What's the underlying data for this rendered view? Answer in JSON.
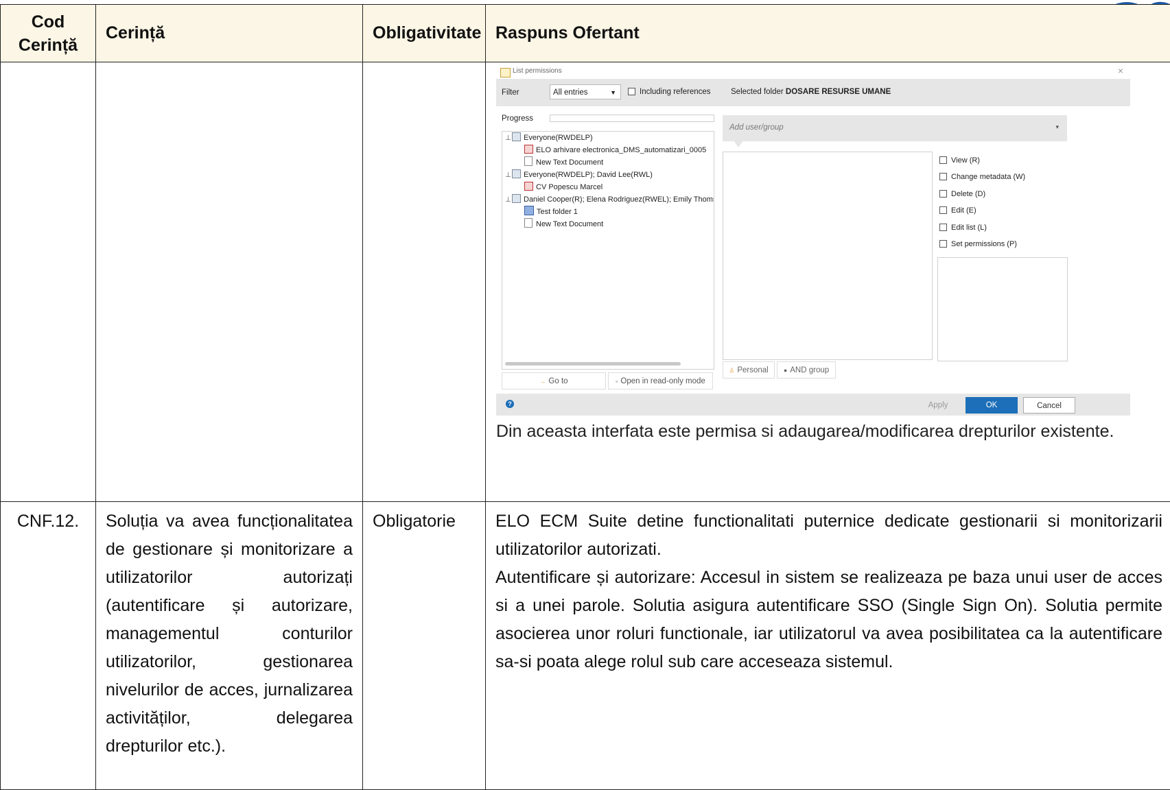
{
  "table": {
    "headers": [
      "Cod Cerință",
      "Cerință",
      "Obligativitate",
      "Raspuns Ofertant"
    ],
    "row1": {
      "code": "",
      "requirement": "",
      "mandatory": "",
      "response_text": "Din aceasta interfata este permisa si adaugarea/modificarea drepturilor existente."
    },
    "row2": {
      "code": "CNF.12.",
      "requirement": "Soluția va avea funcționalitatea de gestionare și monitorizare a utilizatorilor autorizați (autentificare și autorizare, managementul conturilor utilizatorilor, gestionarea nivelurilor de acces, jurnalizarea activităților, delegarea drepturilor etc.).",
      "mandatory": "Obligatorie",
      "response_p1": "ELO ECM Suite detine functionalitati puternice dedicate gestionarii si monitorizarii utilizatorilor autorizati.",
      "response_p2": "Autentificare și autorizare: Accesul in sistem se realizeaza pe baza unui user de acces si a unei parole. Solutia asigura autentificare SSO (Single Sign On). Solutia permite asocierea unor roluri functionale, iar utilizatorul va avea posibilitatea ca la autentificare sa-si poata alege rolul sub care acceseaza sistemul."
    }
  },
  "dialog": {
    "title": "List permissions",
    "filter_label": "Filter",
    "filter_value": "All entries",
    "including_references": "Including references",
    "selected_folder_prefix": "Selected folder",
    "selected_folder_name": "DOSARE RESURSE UMANE",
    "progress_label": "Progress",
    "tree": [
      {
        "label": "Everyone(RWDELP)",
        "icon": "group-icon",
        "level": 0
      },
      {
        "label": "ELO arhivare electronica_DMS_automatizari_0005",
        "icon": "pdf-icon",
        "level": 1
      },
      {
        "label": "New Text Document",
        "icon": "text-document-icon",
        "level": 1
      },
      {
        "label": "Everyone(RWDELP); David Lee(RWL)",
        "icon": "group-icon",
        "level": 0
      },
      {
        "label": "CV Popescu Marcel",
        "icon": "pdf-icon",
        "level": 1
      },
      {
        "label": "Daniel Cooper(R); Elena Rodriguez(RWEL); Emily Thoms",
        "icon": "group-icon",
        "level": 0
      },
      {
        "label": "Test folder 1",
        "icon": "folder-icon",
        "level": 1
      },
      {
        "label": "New Text Document",
        "icon": "text-document-icon",
        "level": 1
      }
    ],
    "add_user_placeholder": "Add user/group",
    "permissions": [
      "View (R)",
      "Change metadata (W)",
      "Delete (D)",
      "Edit (E)",
      "Edit list (L)",
      "Set permissions (P)"
    ],
    "goto_label": "Go to",
    "open_readonly_label": "Open in read-only mode",
    "personal_label": "Personal",
    "and_group_label": "AND group",
    "apply_label": "Apply",
    "ok_label": "OK",
    "cancel_label": "Cancel",
    "accent_color": "#1c6fb8"
  },
  "colors": {
    "header_bg": "#fbf6e6",
    "logo_blue": "#1c5aa8"
  }
}
